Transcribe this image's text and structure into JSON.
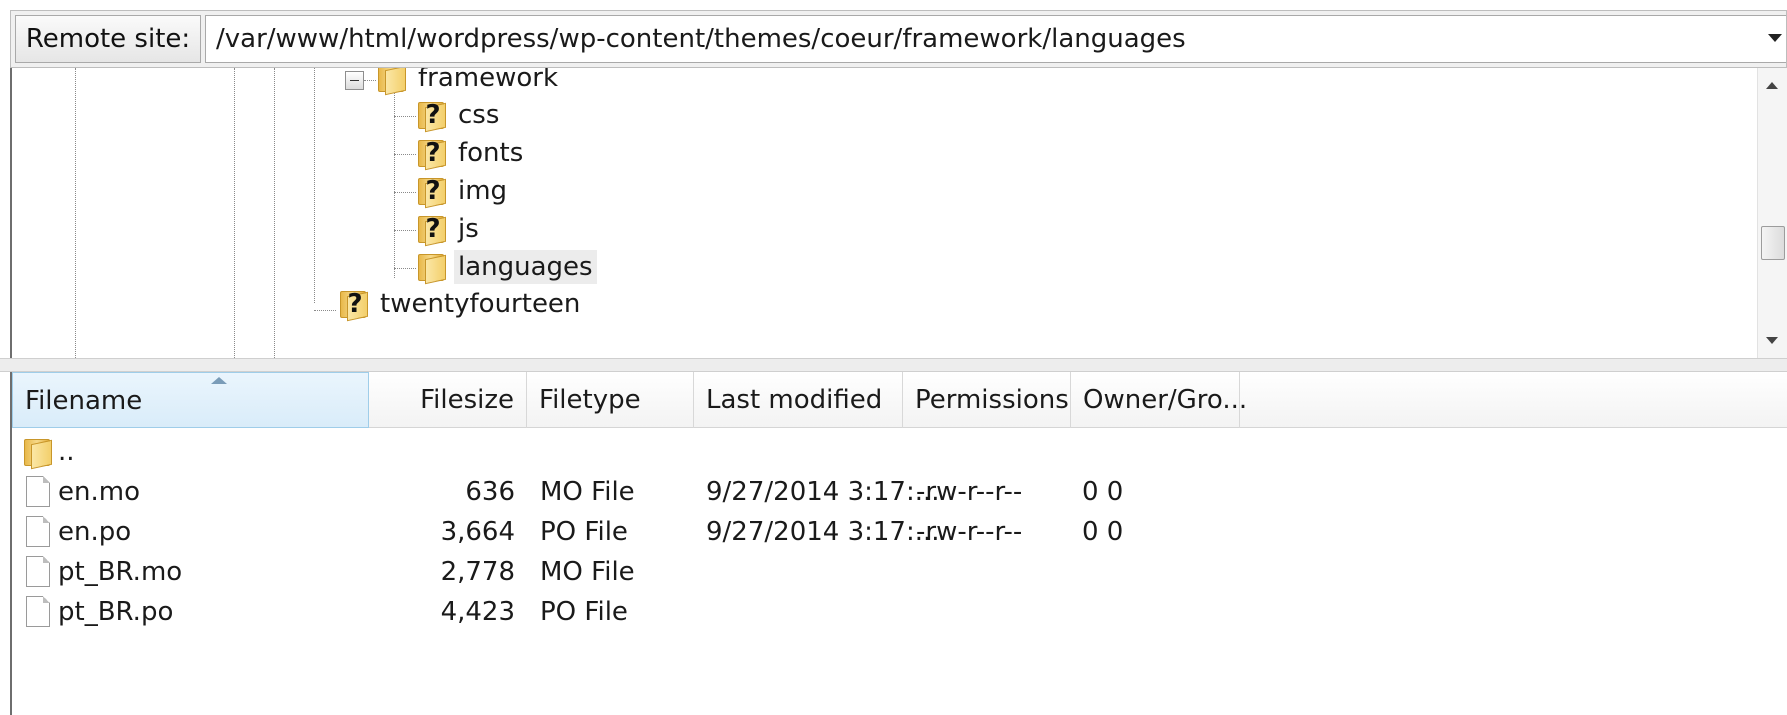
{
  "remote": {
    "label": "Remote site:",
    "path": "/var/www/html/wordpress/wp-content/themes/coeur/framework/languages"
  },
  "tree": {
    "nodes": [
      {
        "label": "framework",
        "icon": "folder-open-icon"
      },
      {
        "label": "css",
        "icon": "folder-unknown-icon"
      },
      {
        "label": "fonts",
        "icon": "folder-unknown-icon"
      },
      {
        "label": "img",
        "icon": "folder-unknown-icon"
      },
      {
        "label": "js",
        "icon": "folder-unknown-icon"
      },
      {
        "label": "languages",
        "icon": "folder-icon",
        "selected": true
      },
      {
        "label": "twentyfourteen",
        "icon": "folder-unknown-icon"
      }
    ],
    "unknown_glyph": "?"
  },
  "filelist": {
    "columns": [
      "Filename",
      "Filesize",
      "Filetype",
      "Last modified",
      "Permissions",
      "Owner/Gro..."
    ],
    "sorted_column": "Filename",
    "rows": [
      {
        "name": "..",
        "size": "",
        "type": "",
        "modified": "",
        "perms": "",
        "owner": "",
        "icon": "folder-icon"
      },
      {
        "name": "en.mo",
        "size": "636",
        "type": "MO File",
        "modified": "9/27/2014 3:17:...",
        "perms": "-rw-r--r--",
        "owner": "0 0",
        "icon": "file-icon"
      },
      {
        "name": "en.po",
        "size": "3,664",
        "type": "PO File",
        "modified": "9/27/2014 3:17:...",
        "perms": "-rw-r--r--",
        "owner": "0 0",
        "icon": "file-icon"
      },
      {
        "name": "pt_BR.mo",
        "size": "2,778",
        "type": "MO File",
        "modified": "",
        "perms": "",
        "owner": "",
        "icon": "file-icon"
      },
      {
        "name": "pt_BR.po",
        "size": "4,423",
        "type": "PO File",
        "modified": "",
        "perms": "",
        "owner": "",
        "icon": "file-icon"
      }
    ]
  }
}
